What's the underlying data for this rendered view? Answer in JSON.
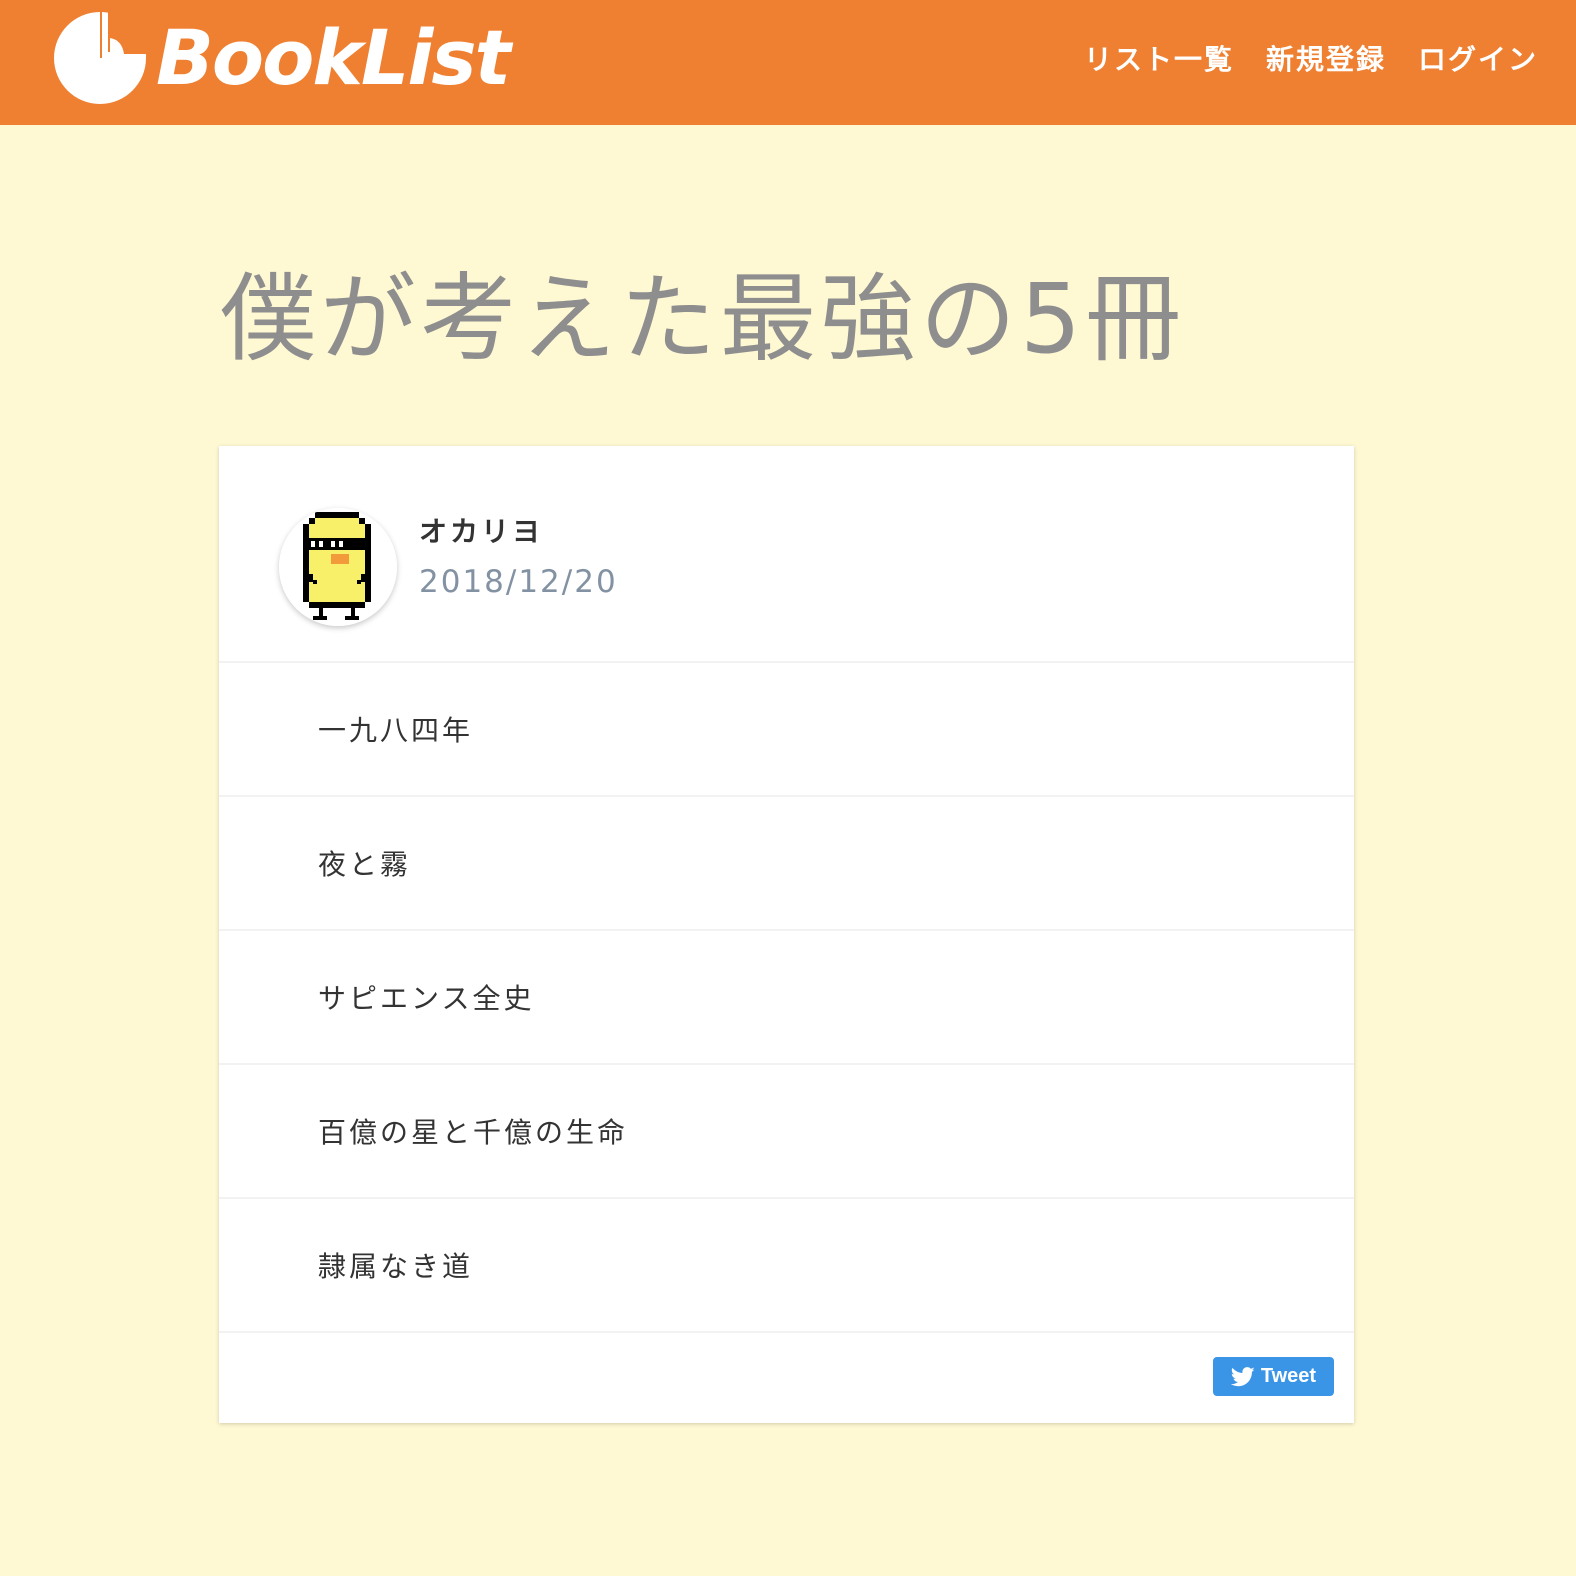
{
  "header": {
    "logo_text": "BookList",
    "nav": [
      {
        "label": "リスト一覧"
      },
      {
        "label": "新規登録"
      },
      {
        "label": "ログイン"
      }
    ]
  },
  "page": {
    "title": "僕が考えた最強の5冊"
  },
  "card": {
    "author": "オカリヨ",
    "date": "2018/12/20",
    "books": [
      {
        "title": "一九八四年"
      },
      {
        "title": "夜と霧"
      },
      {
        "title": "サピエンス全史"
      },
      {
        "title": "百億の星と千億の生命"
      },
      {
        "title": "隷属なき道"
      }
    ],
    "tweet_label": "Tweet"
  },
  "colors": {
    "header_bg": "#ef7f31",
    "page_bg": "#fef8d3",
    "tweet_bg": "#3b95e6"
  },
  "icons": {
    "logo": "booklist-logo-icon",
    "avatar": "pixel-chick-avatar",
    "tweet": "twitter-bird-icon"
  }
}
